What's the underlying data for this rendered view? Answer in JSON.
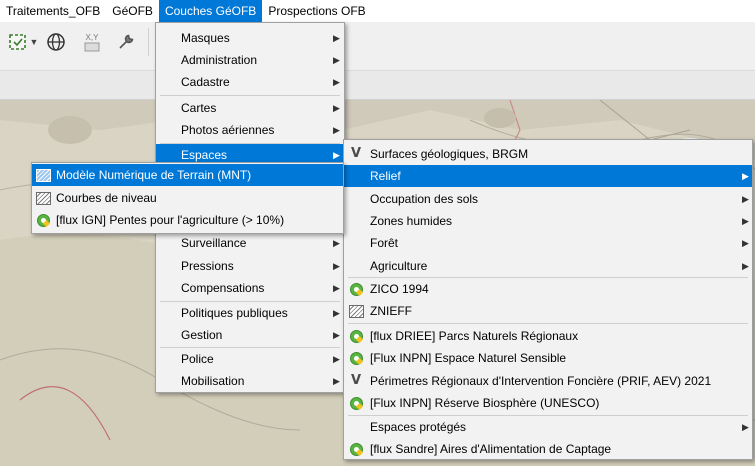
{
  "menubar": {
    "items": [
      {
        "label": "Traitements_OFB",
        "active": false
      },
      {
        "label": "GéOFB",
        "active": false
      },
      {
        "label": "Couches GéOFB",
        "active": true
      },
      {
        "label": "Prospections OFB",
        "active": false
      }
    ]
  },
  "toolbar": {
    "icons": [
      "layer-select-icon",
      "dropdown-arrow-icon",
      "globe-icon",
      "xy-coordinates-icon",
      "wrench-icon"
    ],
    "xy_label": "X,Y"
  },
  "menu_main": {
    "items": [
      {
        "label": "Masques",
        "submenu": true
      },
      {
        "label": "Administration",
        "submenu": true
      },
      {
        "label": "Cadastre",
        "submenu": true
      },
      {
        "label": "Cartes",
        "submenu": true
      },
      {
        "label": "Photos aériennes",
        "submenu": true
      },
      {
        "label": "Espaces",
        "submenu": true,
        "highlighted": true
      },
      {
        "label": "Surveillance",
        "submenu": true
      },
      {
        "label": "Pressions",
        "submenu": true
      },
      {
        "label": "Compensations",
        "submenu": true
      },
      {
        "label": "Politiques publiques",
        "submenu": true
      },
      {
        "label": "Gestion",
        "submenu": true
      },
      {
        "label": "Police",
        "submenu": true
      },
      {
        "label": "Mobilisation",
        "submenu": true
      }
    ]
  },
  "menu_espaces": {
    "items": [
      {
        "label": "Surfaces géologiques, BRGM",
        "icon": "vector-layer-icon"
      },
      {
        "label": "Relief",
        "submenu": true,
        "highlighted": true
      },
      {
        "label": "Occupation des sols",
        "submenu": true
      },
      {
        "label": "Zones humides",
        "submenu": true
      },
      {
        "label": "Forêt",
        "submenu": true
      },
      {
        "label": "Agriculture",
        "submenu": true
      },
      {
        "label": "ZICO 1994",
        "icon": "qgis-wms-icon"
      },
      {
        "label": "ZNIEFF",
        "icon": "raster-layer-icon"
      },
      {
        "label": "[flux DRIEE] Parcs Naturels Régionaux",
        "icon": "qgis-wms-icon"
      },
      {
        "label": "[Flux INPN] Espace Naturel Sensible",
        "icon": "qgis-wms-icon"
      },
      {
        "label": "Périmetres Régionaux d'Intervention Foncière (PRIF, AEV) 2021",
        "icon": "vector-layer-icon"
      },
      {
        "label": "[Flux INPN] Réserve Biosphère (UNESCO)",
        "icon": "qgis-wms-icon"
      },
      {
        "label": "Espaces protégés",
        "submenu": true
      },
      {
        "label": "[flux Sandre] Aires d'Alimentation de Captage",
        "icon": "qgis-wms-icon"
      }
    ]
  },
  "menu_relief": {
    "items": [
      {
        "label": "Modèle Numérique de Terrain (MNT)",
        "icon": "raster-layer-icon",
        "highlighted": true
      },
      {
        "label": "Courbes de niveau",
        "icon": "raster-layer-icon"
      },
      {
        "label": "[flux IGN] Pentes pour l'agriculture (> 10%)",
        "icon": "qgis-wms-icon"
      }
    ]
  },
  "colors": {
    "highlight": "#0078d7",
    "menu_bg": "#f2f2f2",
    "qgis_green": "#59b443"
  }
}
